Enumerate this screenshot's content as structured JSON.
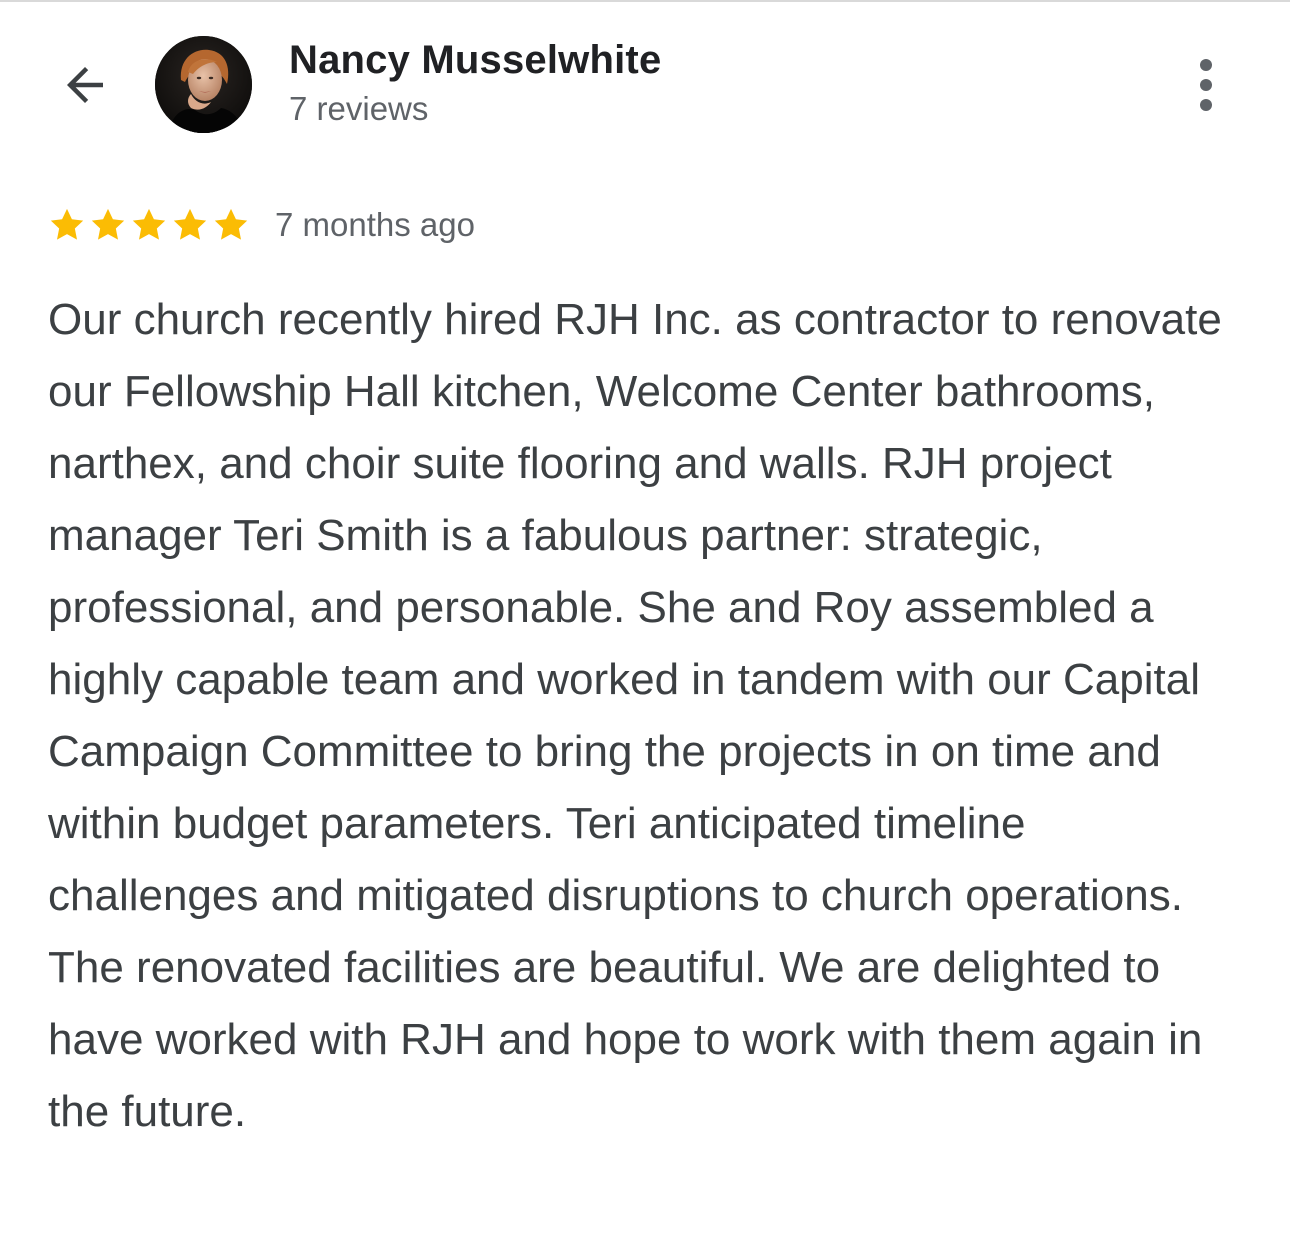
{
  "header": {
    "back_icon": "arrow-left-icon",
    "user_name": "Nancy Musselwhite",
    "review_count": "7 reviews",
    "more_icon": "more-vert-icon"
  },
  "review": {
    "rating": 5,
    "rating_max": 5,
    "star_color": "#fbbc04",
    "time_ago": "7 months ago",
    "text": "Our church recently hired RJH Inc. as contractor to renovate our Fellowship Hall kitchen, Welcome Center bathrooms, narthex, and choir suite flooring and walls. RJH project manager Teri Smith is a fabulous partner: strategic, professional, and personable. She and Roy assembled a highly capable team and worked in tandem with our Capital Campaign Committee to bring the projects in on time and within budget parameters. Teri anticipated timeline challenges and mitigated disruptions to church operations. The renovated facilities are beautiful. We are delighted to have worked with RJH and hope to work with them again in the future."
  }
}
